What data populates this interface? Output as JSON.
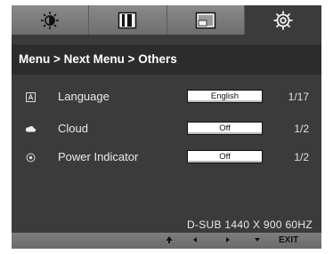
{
  "tabs": [
    {
      "name": "brightness",
      "icon": "brightness-icon"
    },
    {
      "name": "picture",
      "icon": "picture-icon"
    },
    {
      "name": "function",
      "icon": "window-icon"
    },
    {
      "name": "setup",
      "icon": "gear-icon",
      "active": true
    }
  ],
  "breadcrumb": "Menu > Next Menu > Others",
  "settings": [
    {
      "label": "Language",
      "value": "English",
      "count": "1/17",
      "icon": "language-icon"
    },
    {
      "label": "Cloud",
      "value": "Off",
      "count": "1/2",
      "icon": "cloud-icon"
    },
    {
      "label": "Power Indicator",
      "value": "Off",
      "count": "1/2",
      "icon": "power-indicator-icon"
    }
  ],
  "status": "D-SUB 1440 X 900  60HZ",
  "nav": {
    "up": "up-arrow-icon",
    "left": "left-arrow-icon",
    "right": "right-arrow-icon",
    "down": "down-arrow-icon",
    "exit_label": "EXIT"
  },
  "colors": {
    "panel": "#3b3b3b",
    "title_bar": "#2c2c2c",
    "tab_inactive": "#7c7c7c",
    "value_box": "#ffffff"
  }
}
